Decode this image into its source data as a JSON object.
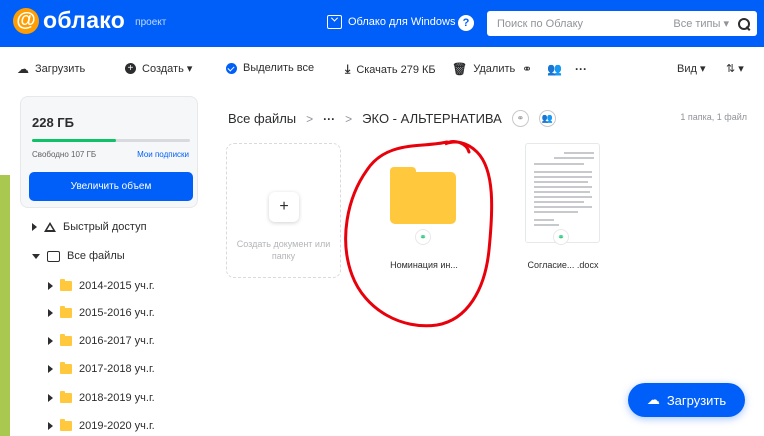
{
  "header": {
    "logo_text": "облако",
    "logo_badge": "проект",
    "windows_link": "Облако для Windows",
    "help": "?",
    "search_placeholder": "Поиск по Облаку",
    "search_types": "Все типы ▾"
  },
  "toolbar": {
    "upload": "Загрузить",
    "create": "Создать ▾",
    "select_all": "Выделить все",
    "download": "Скачать 279 КБ",
    "delete": "Удалить",
    "more": "···",
    "view": "Вид ▾",
    "sort": "⇅ ▾"
  },
  "storage": {
    "total": "228 ГБ",
    "free": "Свободно 107 ГБ",
    "subscriptions": "Мои подписки",
    "increase_button": "Увеличить объем",
    "used_fraction": 0.53
  },
  "sidebar": {
    "quick_access": "Быстрый доступ",
    "all_files": "Все файлы",
    "folders": [
      "2014-2015 уч.г.",
      "2015-2016 уч.г.",
      "2016-2017 уч.г.",
      "2017-2018 уч.г.",
      "2018-2019 уч.г.",
      "2019-2020 уч.г."
    ]
  },
  "main": {
    "breadcrumb_root": "Все файлы",
    "breadcrumb_sep": ">",
    "breadcrumb_more": "···",
    "breadcrumb_current": "ЭКО - АЛЬТЕРНАТИВА",
    "count": "1 папка, 1 файл",
    "create_label": "Создать документ или папку",
    "folder_name": "Номинация ин...",
    "doc_name": "Согласие... .docx"
  },
  "fab": {
    "upload": "Загрузить"
  },
  "colors": {
    "brand": "#005ff9",
    "folder": "#ffc83d",
    "annotation": "#e8000b"
  }
}
